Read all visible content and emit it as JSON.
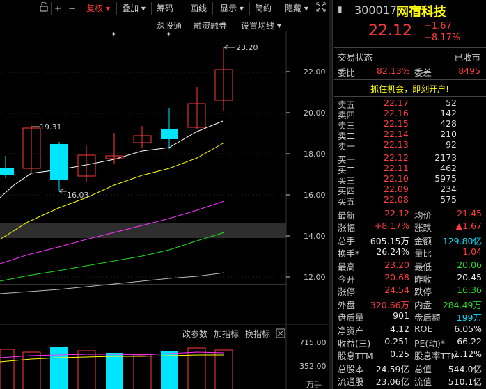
{
  "toolbar": {
    "items": [
      {
        "label": "+"
      },
      {
        "label": "−"
      },
      {
        "label": "复权 ▾"
      },
      {
        "label": "叠加 ▾"
      },
      {
        "label": "筹码"
      },
      {
        "label": "画线"
      },
      {
        "label": "显示 ▾"
      },
      {
        "label": "简约"
      },
      {
        "label": "隐藏 ▾"
      }
    ]
  },
  "chart_links": {
    "a": "深股通",
    "b": "融资融券",
    "c": "设置均线 ▾"
  },
  "price_axis": [
    "22.00",
    "20.00",
    "18.00",
    "16.00",
    "14.00",
    "12.00"
  ],
  "annotations": {
    "high": "23.20",
    "mid": "19.31",
    "low": "16.03"
  },
  "volume_toolbar": {
    "a": "改参数",
    "b": "加指标",
    "c": "换指标"
  },
  "volume_axis": [
    "715.00",
    "352.00",
    "万手"
  ],
  "stock": {
    "code": "300017",
    "name": "网宿科技",
    "price": "22.12",
    "change": "+1.67",
    "change_pct": "+8.17%"
  },
  "status": {
    "label": "交易状态",
    "value": "已收市"
  },
  "weibi": {
    "l1": "委比",
    "v1": "82.13%",
    "l2": "委差",
    "v2": "8495"
  },
  "promo": "抓住机会，即刻开户!",
  "sells": [
    {
      "label": "卖五",
      "price": "22.17",
      "vol": "52"
    },
    {
      "label": "卖四",
      "price": "22.16",
      "vol": "142"
    },
    {
      "label": "卖三",
      "price": "22.15",
      "vol": "428"
    },
    {
      "label": "卖二",
      "price": "22.14",
      "vol": "210"
    },
    {
      "label": "卖一",
      "price": "22.13",
      "vol": "92"
    }
  ],
  "buys": [
    {
      "label": "买一",
      "price": "22.12",
      "vol": "2173"
    },
    {
      "label": "买二",
      "price": "22.11",
      "vol": "462"
    },
    {
      "label": "买三",
      "price": "22.10",
      "vol": "5975"
    },
    {
      "label": "买四",
      "price": "22.09",
      "vol": "234"
    },
    {
      "label": "买五",
      "price": "22.08",
      "vol": "575"
    }
  ],
  "stats": [
    {
      "l1": "最新",
      "v1": "22.12",
      "c1": "red",
      "l2": "均价",
      "v2": "21.45",
      "c2": "red"
    },
    {
      "l1": "涨幅",
      "v1": "+8.17%",
      "c1": "red",
      "l2": "涨跌",
      "v2": "▲1.67",
      "c2": "red"
    },
    {
      "l1": "总手",
      "v1": "605.15万",
      "c1": "white",
      "l2": "金额",
      "v2": "129.80亿",
      "c2": "cyan"
    },
    {
      "l1": "换手*",
      "v1": "26.24%",
      "c1": "white",
      "l2": "量比",
      "v2": "1.04",
      "c2": "red"
    },
    {
      "l1": "最高",
      "v1": "23.20",
      "c1": "red",
      "l2": "最低",
      "v2": "20.06",
      "c2": "green"
    },
    {
      "l1": "今开",
      "v1": "20.68",
      "c1": "red",
      "l2": "昨收",
      "v2": "20.45",
      "c2": "white"
    },
    {
      "l1": "涨停",
      "v1": "24.54",
      "c1": "red",
      "l2": "跌停",
      "v2": "16.36",
      "c2": "green"
    },
    {
      "l1": "外盘",
      "v1": "320.66万",
      "c1": "red",
      "l2": "内盘",
      "v2": "284.49万",
      "c2": "green"
    },
    {
      "l1": "盘后量",
      "v1": "901",
      "c1": "white",
      "l2": "盘后额",
      "v2": "199万",
      "c2": "cyan"
    },
    {
      "l1": "净资产",
      "v1": "4.12",
      "c1": "white",
      "l2": "ROE",
      "v2": "6.05%",
      "c2": "white"
    },
    {
      "l1": "收益(三)",
      "v1": "0.251",
      "c1": "white",
      "l2": "PE(动)*",
      "v2": "66.22",
      "c2": "white"
    },
    {
      "l1": "股息TTM",
      "v1": "0.25",
      "c1": "white",
      "l2": "股息率TTM",
      "v2": "1.12%",
      "c2": "white"
    },
    {
      "l1": "总股本",
      "v1": "24.59亿",
      "c1": "white",
      "l2": "总值",
      "v2": "544.0亿",
      "c2": "white"
    },
    {
      "l1": "流通股",
      "v1": "23.06亿",
      "c1": "white",
      "l2": "流值",
      "v2": "510.1亿",
      "c2": "white"
    }
  ],
  "colors": {
    "up": "#ff3b3b",
    "down": "#00e5ff",
    "ma5": "#ffffff",
    "ma10": "#ffff00",
    "ma20": "#ff33ff",
    "ma30": "#22dd22"
  }
}
